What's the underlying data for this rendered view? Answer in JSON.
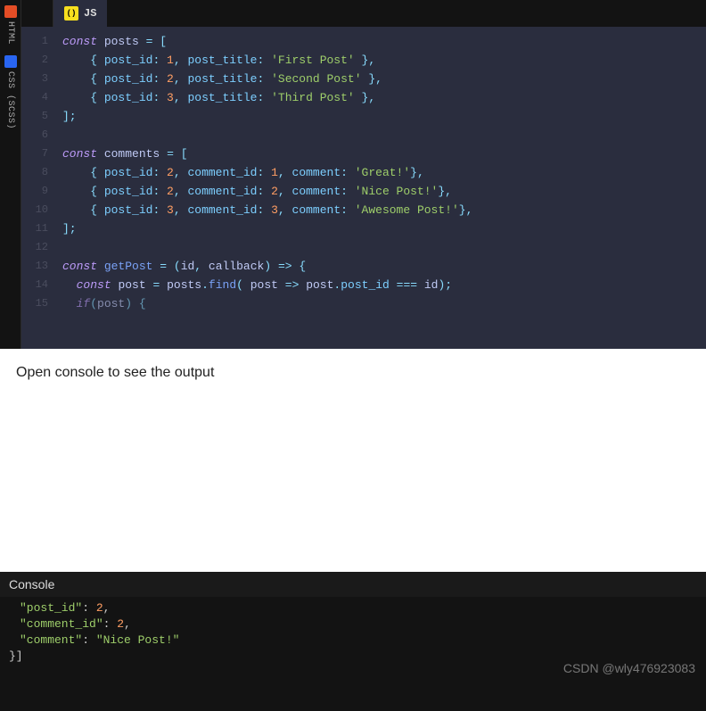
{
  "sideTabs": {
    "html": "HTML",
    "css": "CSS (SCSS)"
  },
  "activeTab": {
    "label": "JS",
    "iconText": "()"
  },
  "lineNumbers": [
    "1",
    "2",
    "3",
    "4",
    "5",
    "6",
    "7",
    "8",
    "9",
    "10",
    "11",
    "12",
    "13",
    "14",
    "15"
  ],
  "code": {
    "l1": {
      "kw": "const",
      "sp": " ",
      "var": "posts",
      "sp2": " ",
      "op": "=",
      "sp3": " ",
      "p": "["
    },
    "l2": {
      "ind": "    ",
      "p1": "{ ",
      "prop1": "post_id",
      "c1": ": ",
      "num": "1",
      "c2": ", ",
      "prop2": "post_title",
      "c3": ": ",
      "str": "'First Post'",
      "p2": " },"
    },
    "l3": {
      "ind": "    ",
      "p1": "{ ",
      "prop1": "post_id",
      "c1": ": ",
      "num": "2",
      "c2": ", ",
      "prop2": "post_title",
      "c3": ": ",
      "str": "'Second Post'",
      "p2": " },"
    },
    "l4": {
      "ind": "    ",
      "p1": "{ ",
      "prop1": "post_id",
      "c1": ": ",
      "num": "3",
      "c2": ", ",
      "prop2": "post_title",
      "c3": ": ",
      "str": "'Third Post'",
      "p2": " },"
    },
    "l5": {
      "p": "];"
    },
    "l7": {
      "kw": "const",
      "sp": " ",
      "var": "comments",
      "sp2": " ",
      "op": "=",
      "sp3": " ",
      "p": "["
    },
    "l8": {
      "ind": "    ",
      "p1": "{ ",
      "prop1": "post_id",
      "c1": ": ",
      "num1": "2",
      "c2": ", ",
      "prop2": "comment_id",
      "c3": ": ",
      "num2": "1",
      "c4": ", ",
      "prop3": "comment",
      "c5": ": ",
      "str": "'Great!'",
      "p2": "},"
    },
    "l9": {
      "ind": "    ",
      "p1": "{ ",
      "prop1": "post_id",
      "c1": ": ",
      "num1": "2",
      "c2": ", ",
      "prop2": "comment_id",
      "c3": ": ",
      "num2": "2",
      "c4": ", ",
      "prop3": "comment",
      "c5": ": ",
      "str": "'Nice Post!'",
      "p2": "},"
    },
    "l10": {
      "ind": "    ",
      "p1": "{ ",
      "prop1": "post_id",
      "c1": ": ",
      "num1": "3",
      "c2": ", ",
      "prop2": "comment_id",
      "c3": ": ",
      "num2": "3",
      "c4": ", ",
      "prop3": "comment",
      "c5": ": ",
      "str": "'Awesome Post!'",
      "p2": "},"
    },
    "l11": {
      "p": "];"
    },
    "l13": {
      "kw": "const",
      "sp": " ",
      "fn": "getPost",
      "sp2": " ",
      "op": "=",
      "sp3": " ",
      "p1": "(",
      "var1": "id",
      "c": ", ",
      "var2": "callback",
      "p2": ") ",
      "arrow": "=>",
      "sp4": " ",
      "p3": "{"
    },
    "l14": {
      "ind": "  ",
      "kw": "const",
      "sp": " ",
      "var": "post",
      "sp2": " ",
      "op": "=",
      "sp3": " ",
      "obj": "posts",
      "dot": ".",
      "fn": "find",
      "p1": "( ",
      "var2": "post",
      "sp4": " ",
      "arrow": "=>",
      "sp5": " ",
      "obj2": "post",
      "dot2": ".",
      "prop": "post_id",
      "sp6": " ",
      "eq": "===",
      "sp7": " ",
      "var3": "id",
      "p2": ");"
    },
    "l15": {
      "ind": "  ",
      "kw": "if",
      "p1": "(",
      "var": "post",
      "p2": ") {"
    }
  },
  "output": {
    "message": "Open console to see the output"
  },
  "console": {
    "title": "Console",
    "lines": {
      "l1": {
        "k": "\"post_id\"",
        "c": ": ",
        "v": "2",
        "t": ","
      },
      "l2": {
        "k": "\"comment_id\"",
        "c": ": ",
        "v": "2",
        "t": ","
      },
      "l3": {
        "k": "\"comment\"",
        "c": ": ",
        "v": "\"Nice Post!\""
      },
      "l4": {
        "p": "}]"
      }
    }
  },
  "watermark": "CSDN @wly476923083"
}
